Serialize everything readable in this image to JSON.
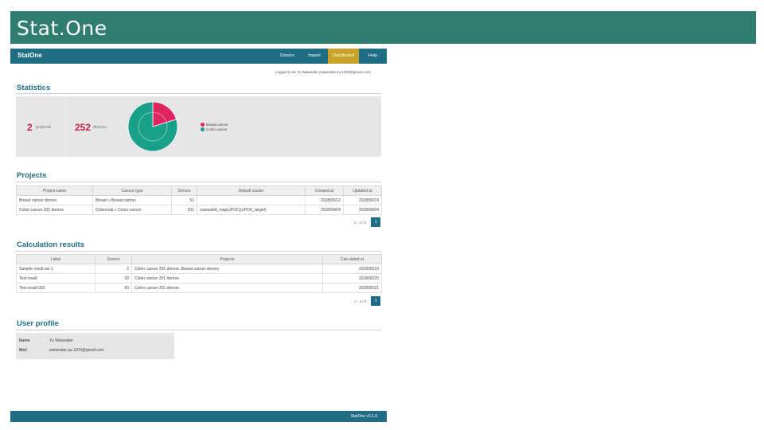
{
  "slide": {
    "title": "Stat.One"
  },
  "app": {
    "logo": "StatOne",
    "nav": [
      {
        "label": "Donors"
      },
      {
        "label": "Import"
      },
      {
        "label": "Dashboard",
        "active": true
      },
      {
        "label": "Help"
      }
    ],
    "login_info": "Logged in as Yu Watanabe (watanabe.yu.1203@gmail.com)"
  },
  "statistics": {
    "title": "Statistics",
    "projects_count": "2",
    "projects_label": "projects",
    "donors_count": "252",
    "donors_label": "donors",
    "legend": [
      {
        "label": "Breast cancer",
        "color": "#e0245e"
      },
      {
        "label": "Colon cancer",
        "color": "#18a08b"
      }
    ],
    "chart_data": {
      "type": "pie",
      "categories": [
        "Breast cancer",
        "Colon cancer"
      ],
      "values": [
        51,
        201
      ],
      "colors": [
        "#e0245e",
        "#18a08b"
      ]
    }
  },
  "projects": {
    "title": "Projects",
    "columns": [
      "Project name",
      "Cancer type",
      "Donors",
      "Default cluster",
      "Created at",
      "Updated at"
    ],
    "rows": [
      [
        "Breast cancer donors",
        "Breast » Breast cancer",
        "51",
        "",
        "2018/06/12",
        "2018/06/19"
      ],
      [
        "Colon cancer 201 donors",
        "Colorectal » Colon cancer",
        "201",
        "example8_map(uPOC)(uPOC_target)",
        "2018/04/04",
        "2018/04/04"
      ]
    ],
    "pager_text": "1 - 2 / 2",
    "pager_page": "1"
  },
  "calculations": {
    "title": "Calculation results",
    "columns": [
      "Label",
      "Donors",
      "Projects",
      "Calculated at"
    ],
    "rows": [
      [
        "Sample result set 1",
        "2",
        "Colon cancer 201 donors,  Breast cancer donors",
        "2018/05/15"
      ],
      [
        "Test result",
        "20",
        "Colon cancer 201 donors",
        "2018/05/20"
      ],
      [
        "Test result 003",
        "50",
        "Colon cancer 201 donors",
        "2018/05/21"
      ]
    ],
    "pager_text": "1 - 3 / 3",
    "pager_page": "1"
  },
  "profile": {
    "title": "User profile",
    "name_label": "Name",
    "name_value": "Yu Watanabe",
    "mail_label": "Mail",
    "mail_value": "watanabe.yu.1203@gmail.com"
  },
  "footer": {
    "text": "StatOne v0.1.0"
  }
}
